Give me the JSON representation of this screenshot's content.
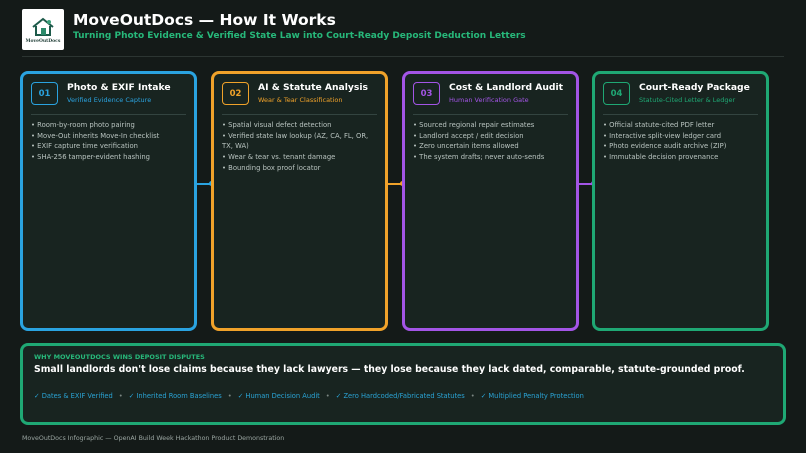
{
  "header": {
    "logo_text": "MoveOutDocs",
    "title": "MoveOutDocs — How It Works",
    "subtitle": "Turning Photo Evidence & Verified State Law into Court-Ready Deposit Deduction Letters"
  },
  "colors": {
    "background": "#141a18",
    "card_bg": "#182420",
    "step1": "#2aa3e0",
    "step2": "#f0a22a",
    "step3": "#a355e6",
    "step4": "#1fa874",
    "accent_green": "#27b87a",
    "tag_blue": "#2aa3d4"
  },
  "steps": [
    {
      "number": "01",
      "title": "Photo & EXIF Intake",
      "subtitle": "Verified Evidence Capture",
      "icon": "camera-icon",
      "items": [
        "• Room-by-room photo pairing",
        "• Move-Out inherits Move-In checklist",
        "• EXIF capture time verification",
        "• SHA-256 tamper-evident hashing"
      ]
    },
    {
      "number": "02",
      "title": "AI & Statute Analysis",
      "subtitle": "Wear & Tear Classification",
      "icon": "brain-icon",
      "items": [
        "• Spatial visual defect detection",
        "• Verified state law lookup (AZ, CA, FL, OR, TX, WA)",
        "• Wear & tear vs. tenant damage",
        "• Bounding box proof locator"
      ]
    },
    {
      "number": "03",
      "title": "Cost & Landlord Audit",
      "subtitle": "Human Verification Gate",
      "icon": "audit-icon",
      "items": [
        "• Sourced regional repair estimates",
        "• Landlord accept / edit decision",
        "• Zero uncertain items allowed",
        "• The system drafts; never auto-sends"
      ]
    },
    {
      "number": "04",
      "title": "Court-Ready Package",
      "subtitle": "Statute-Cited Letter & Ledger",
      "icon": "document-icon",
      "items": [
        "• Official statute-cited PDF letter",
        "• Interactive split-view ledger card",
        "• Photo evidence audit archive (ZIP)",
        "• Immutable decision provenance"
      ]
    }
  ],
  "panel": {
    "kicker": "WHY MOVEOUTDOCS WINS DEPOSIT DISPUTES",
    "headline": "Small landlords don't lose claims because they lack lawyers — they lose because they lack dated, comparable, statute-grounded proof.",
    "tags": [
      "✓ Dates & EXIF Verified",
      "✓ Inherited Room Baselines",
      "✓ Human Decision Audit",
      "✓ Zero Hardcoded/Fabricated Statutes",
      "✓ Multiplied Penalty Protection"
    ],
    "separator": "•"
  },
  "footer": "MoveOutDocs Infographic — OpenAI Build Week Hackathon Product Demonstration"
}
